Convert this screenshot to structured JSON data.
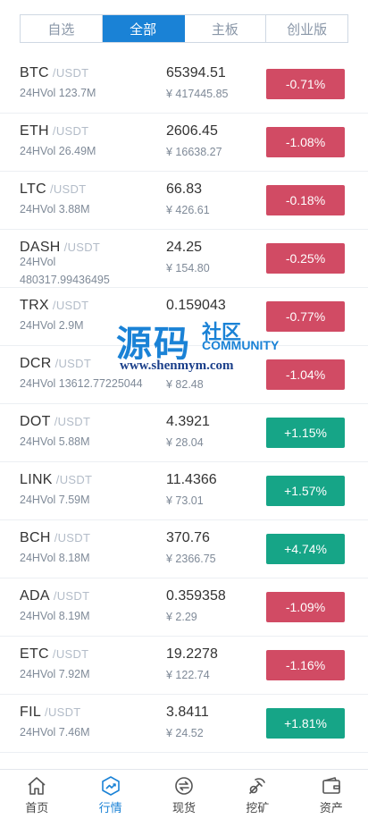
{
  "tabs": [
    {
      "label": "自选",
      "active": false
    },
    {
      "label": "全部",
      "active": true
    },
    {
      "label": "主板",
      "active": false
    },
    {
      "label": "创业版",
      "active": false
    }
  ],
  "markets": [
    {
      "symbol": "BTC",
      "quote": "/USDT",
      "vol": "24HVol 123.7M",
      "price": "65394.51",
      "cny": "¥ 417445.85",
      "change": "-0.71%",
      "dir": "down"
    },
    {
      "symbol": "ETH",
      "quote": "/USDT",
      "vol": "24HVol 26.49M",
      "price": "2606.45",
      "cny": "¥ 16638.27",
      "change": "-1.08%",
      "dir": "down"
    },
    {
      "symbol": "LTC",
      "quote": "/USDT",
      "vol": "24HVol 3.88M",
      "price": "66.83",
      "cny": "¥ 426.61",
      "change": "-0.18%",
      "dir": "down"
    },
    {
      "symbol": "DASH",
      "quote": "/USDT",
      "vol": "24HVol 480317.99436495",
      "price": "24.25",
      "cny": "¥ 154.80",
      "change": "-0.25%",
      "dir": "down"
    },
    {
      "symbol": "TRX",
      "quote": "/USDT",
      "vol": "24HVol 2.9M",
      "price": "0.159043",
      "cny": "",
      "change": "-0.77%",
      "dir": "down"
    },
    {
      "symbol": "DCR",
      "quote": "/USDT",
      "vol": "24HVol 13612.77225044",
      "price": "",
      "cny": "¥ 82.48",
      "change": "-1.04%",
      "dir": "down"
    },
    {
      "symbol": "DOT",
      "quote": "/USDT",
      "vol": "24HVol 5.88M",
      "price": "4.3921",
      "cny": "¥ 28.04",
      "change": "+1.15%",
      "dir": "up"
    },
    {
      "symbol": "LINK",
      "quote": "/USDT",
      "vol": "24HVol 7.59M",
      "price": "11.4366",
      "cny": "¥ 73.01",
      "change": "+1.57%",
      "dir": "up"
    },
    {
      "symbol": "BCH",
      "quote": "/USDT",
      "vol": "24HVol 8.18M",
      "price": "370.76",
      "cny": "¥ 2366.75",
      "change": "+4.74%",
      "dir": "up"
    },
    {
      "symbol": "ADA",
      "quote": "/USDT",
      "vol": "24HVol 8.19M",
      "price": "0.359358",
      "cny": "¥ 2.29",
      "change": "-1.09%",
      "dir": "down"
    },
    {
      "symbol": "ETC",
      "quote": "/USDT",
      "vol": "24HVol 7.92M",
      "price": "19.2278",
      "cny": "¥ 122.74",
      "change": "-1.16%",
      "dir": "down"
    },
    {
      "symbol": "FIL",
      "quote": "/USDT",
      "vol": "24HVol 7.46M",
      "price": "3.8411",
      "cny": "¥ 24.52",
      "change": "+1.81%",
      "dir": "up"
    }
  ],
  "watermark": {
    "cn": "源码",
    "sq": "社区",
    "en": "COMMUNITY",
    "url": "www.shenmym.com"
  },
  "nav": [
    {
      "label": "首页",
      "icon": "home-icon",
      "active": false
    },
    {
      "label": "行情",
      "icon": "market-chart-icon",
      "active": true
    },
    {
      "label": "现货",
      "icon": "spot-exchange-icon",
      "active": false
    },
    {
      "label": "挖矿",
      "icon": "mining-pickaxe-icon",
      "active": false
    },
    {
      "label": "资产",
      "icon": "wallet-icon",
      "active": false
    }
  ],
  "colors": {
    "accent": "#1a82d6",
    "down": "#d14b64",
    "up": "#16a587"
  }
}
